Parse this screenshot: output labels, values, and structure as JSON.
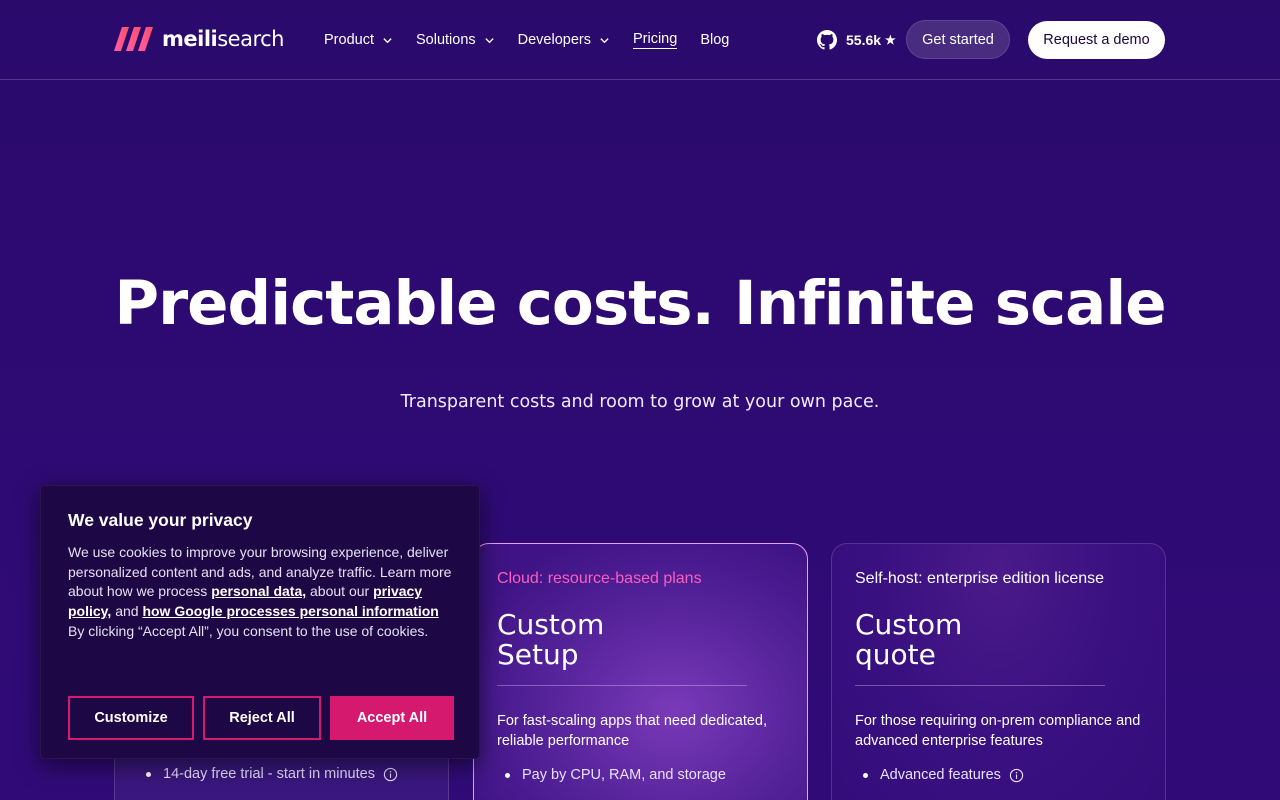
{
  "brand": {
    "name_bold": "meili",
    "name_rest": "search",
    "accent": "#ff4f7b"
  },
  "nav": {
    "items": [
      {
        "label": "Product",
        "dropdown": true
      },
      {
        "label": "Solutions",
        "dropdown": true
      },
      {
        "label": "Developers",
        "dropdown": true
      },
      {
        "label": "Pricing",
        "dropdown": false
      },
      {
        "label": "Blog",
        "dropdown": false
      }
    ]
  },
  "github": {
    "stars": "55.6k",
    "star_glyph": "★",
    "icon": "github-icon"
  },
  "header_buttons": {
    "get_started": "Get started",
    "request_demo": "Request a demo"
  },
  "hero": {
    "title": "Predictable costs. Infinite scale",
    "subtitle": "Transparent costs and room to grow at your own pace."
  },
  "cards": {
    "left": {
      "bullet": "14-day free trial - start in minutes"
    },
    "cloud": {
      "kicker": "Cloud: resource-based plans",
      "title_line1": "Custom",
      "title_line2": "Setup",
      "desc": "For fast-scaling apps that need dedicated, reliable performance",
      "bullet": "Pay by CPU, RAM, and storage"
    },
    "self": {
      "kicker": "Self-host: enterprise edition license",
      "title_line1": "Custom",
      "title_line2": "quote",
      "desc": "For those requiring on-prem compliance and advanced enterprise features",
      "bullet": "Advanced features"
    }
  },
  "cookie": {
    "title": "We value your privacy",
    "text1": "We use cookies to improve your browsing experience, deliver personalized content and ads, and analyze traffic. Learn more about how we process ",
    "link1": "personal data,",
    "text2": " about our ",
    "link2": "privacy policy,",
    "text3": " and ",
    "link3": "how Google processes personal information",
    "text4": "By clicking “Accept All”, you consent to the use of cookies.",
    "customize": "Customize",
    "reject": "Reject All",
    "accept": "Accept All"
  },
  "colors": {
    "background": "#2c0a6e",
    "pink": "#d4196e",
    "kicker_pink": "#ff5cc0"
  }
}
